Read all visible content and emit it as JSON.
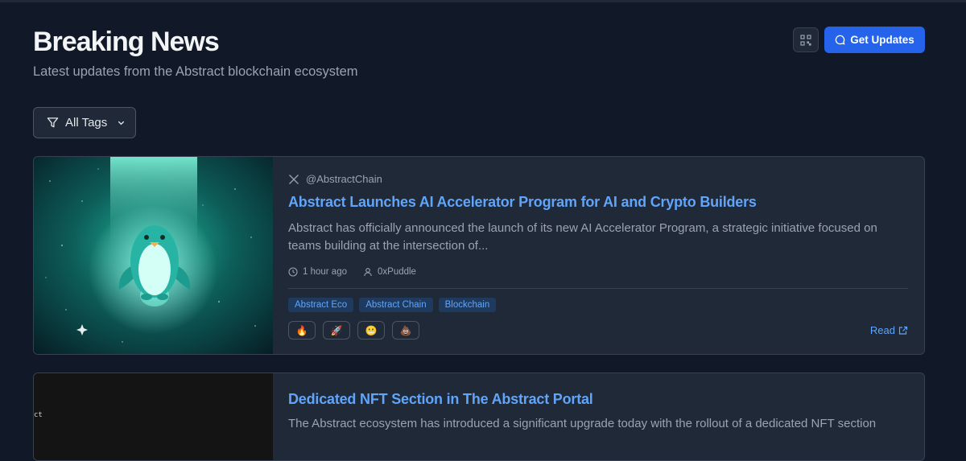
{
  "header": {
    "title": "Breaking News",
    "subtitle": "Latest updates from the Abstract blockchain ecosystem",
    "get_updates_label": "Get Updates"
  },
  "filter": {
    "label": "All Tags"
  },
  "articles": [
    {
      "source": "@AbstractChain",
      "title": "Abstract Launches AI Accelerator Program for AI and Crypto Builders",
      "summary": "Abstract has officially announced the launch of its new AI Accelerator Program, a strategic initiative focused on teams building at the intersection of...",
      "time": "1 hour ago",
      "author": "0xPuddle",
      "tags": [
        "Abstract Eco",
        "Abstract Chain",
        "Blockchain"
      ],
      "reactions": [
        "🔥",
        "🚀",
        "😬",
        "💩"
      ],
      "read_label": "Read"
    },
    {
      "thumb_text": "ct",
      "title": "Dedicated NFT Section in The Abstract Portal",
      "summary": "The Abstract ecosystem has introduced a significant upgrade today with the rollout of a dedicated NFT section"
    }
  ],
  "colors": {
    "background": "#111827",
    "card": "#1f2937",
    "accent": "#2563eb",
    "link": "#60a5fa"
  }
}
